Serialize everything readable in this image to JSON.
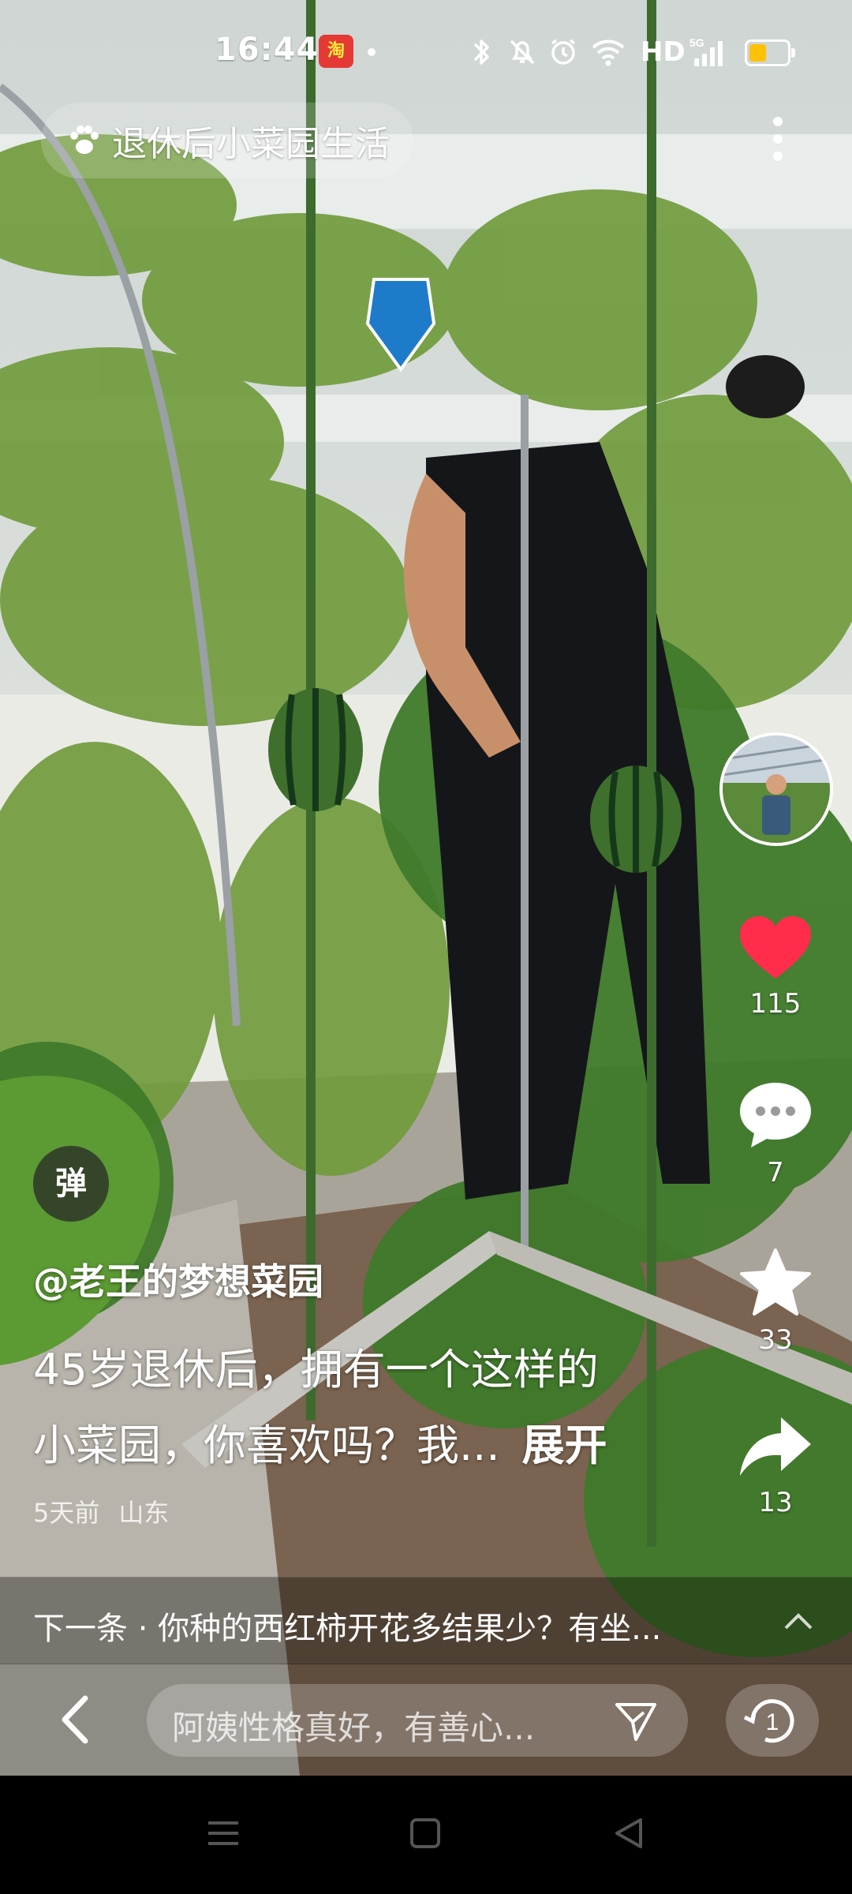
{
  "status_bar": {
    "time": "16:44",
    "app_badge": "淘",
    "network": "HD",
    "signal": "5G",
    "battery_level": 0.45
  },
  "top": {
    "topic_label": "退休后小菜园生活"
  },
  "rail": {
    "like_count": "115",
    "comment_count": "7",
    "favorite_count": "33",
    "share_count": "13",
    "like_color": "#ff2d4b"
  },
  "post": {
    "danmaku_label": "弹",
    "author": "@老王的梦想菜园",
    "description_line1": "45岁退休后，拥有一个这样的",
    "description_line2": "小菜园，你喜欢吗？我...",
    "expand_label": "展开",
    "time_ago": "5天前",
    "location": "山东"
  },
  "next": {
    "text": "下一条 · 你种的西红柿开花多结果少？有坐..."
  },
  "comment_bar": {
    "placeholder": "阿姨性格真好，有善心...",
    "counter": "1"
  }
}
